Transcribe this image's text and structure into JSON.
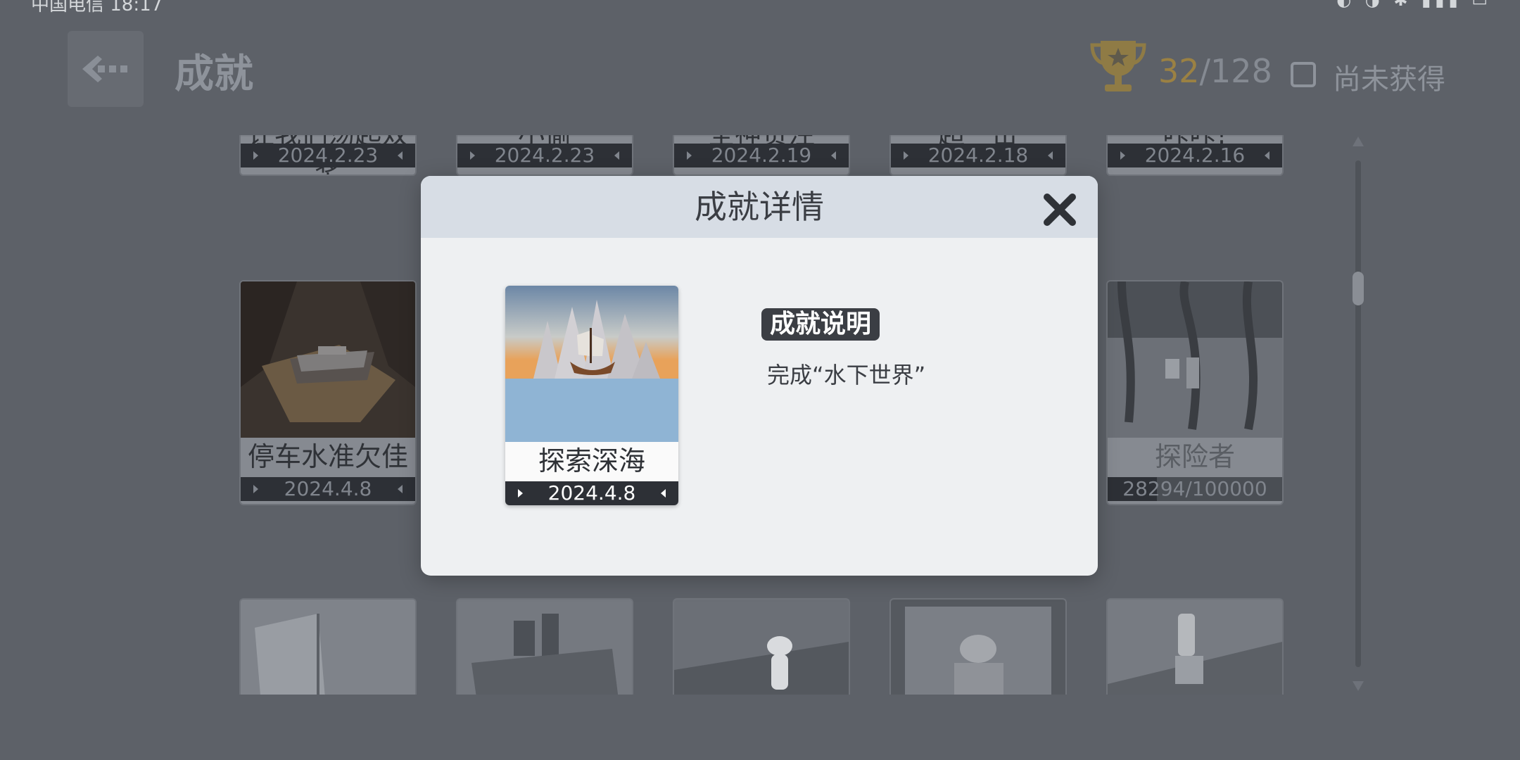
{
  "status_bar": {
    "left_text": "中国电信 18:17",
    "right_text": "◐ ◑ ✱ ▮▮▮ ▭"
  },
  "header": {
    "title": "成就",
    "earned": "32",
    "total": "/128",
    "filter_label": "尚未获得"
  },
  "grid": {
    "row1": [
      {
        "name": "让我们荡起双桨",
        "date": "2024.2.23"
      },
      {
        "name": "小偷",
        "date": "2024.2.23"
      },
      {
        "name": "全神贯注",
        "date": "2024.2.19"
      },
      {
        "name": "超一击",
        "date": "2024.2.18"
      },
      {
        "name": "咔咔!",
        "date": "2024.2.16"
      }
    ],
    "row2": [
      {
        "name": "停车水准欠佳",
        "date": "2024.4.8"
      },
      {
        "name": "探险者",
        "progress": "28294/100000",
        "progress_fraction": 0.283
      }
    ]
  },
  "dialog": {
    "title": "成就详情",
    "card_name": "探索深海",
    "card_date": "2024.4.8",
    "desc_label": "成就说明",
    "desc_text": "完成“水下世界”"
  },
  "icons": [
    "back-icon",
    "trophy-icon",
    "close-icon",
    "scroll-up-icon",
    "scroll-down-icon"
  ]
}
